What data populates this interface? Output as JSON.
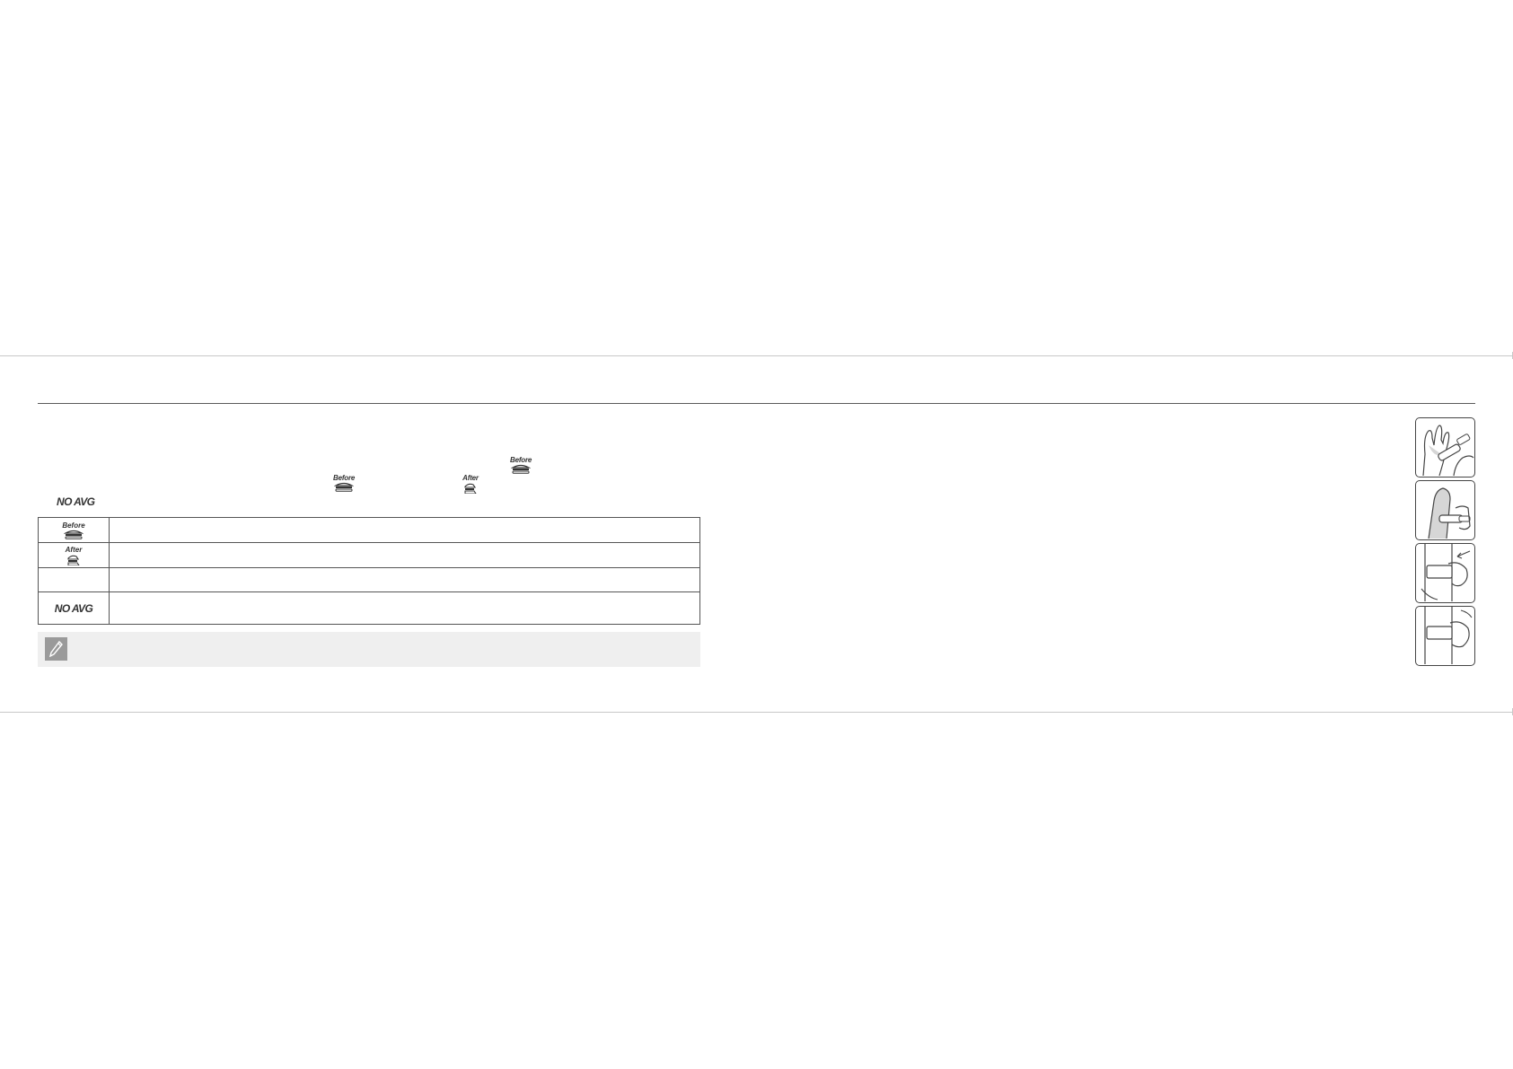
{
  "icons": {
    "before_word": "Before",
    "after_word": "After",
    "no_avg": "NO AVG"
  },
  "legend_rows": [
    {
      "symbol": "before-meal-icon",
      "text": ""
    },
    {
      "symbol": "after-meal-icon",
      "text": ""
    },
    {
      "symbol": "blank",
      "text": ""
    },
    {
      "symbol": "no-avg-icon",
      "text": ""
    }
  ],
  "note": {
    "icon": "pencil-icon",
    "text": ""
  },
  "photos": [
    {
      "name": "fingertip-lancing-illustration"
    },
    {
      "name": "forearm-lancing-illustration"
    },
    {
      "name": "palm-lancing-illustration"
    },
    {
      "name": "palm-pressing-illustration"
    }
  ],
  "colors": {
    "rule": "#5a5a5a",
    "trim": "#c8c8c8",
    "note_bg": "#efefef",
    "note_icon": "#9a9a9a"
  }
}
